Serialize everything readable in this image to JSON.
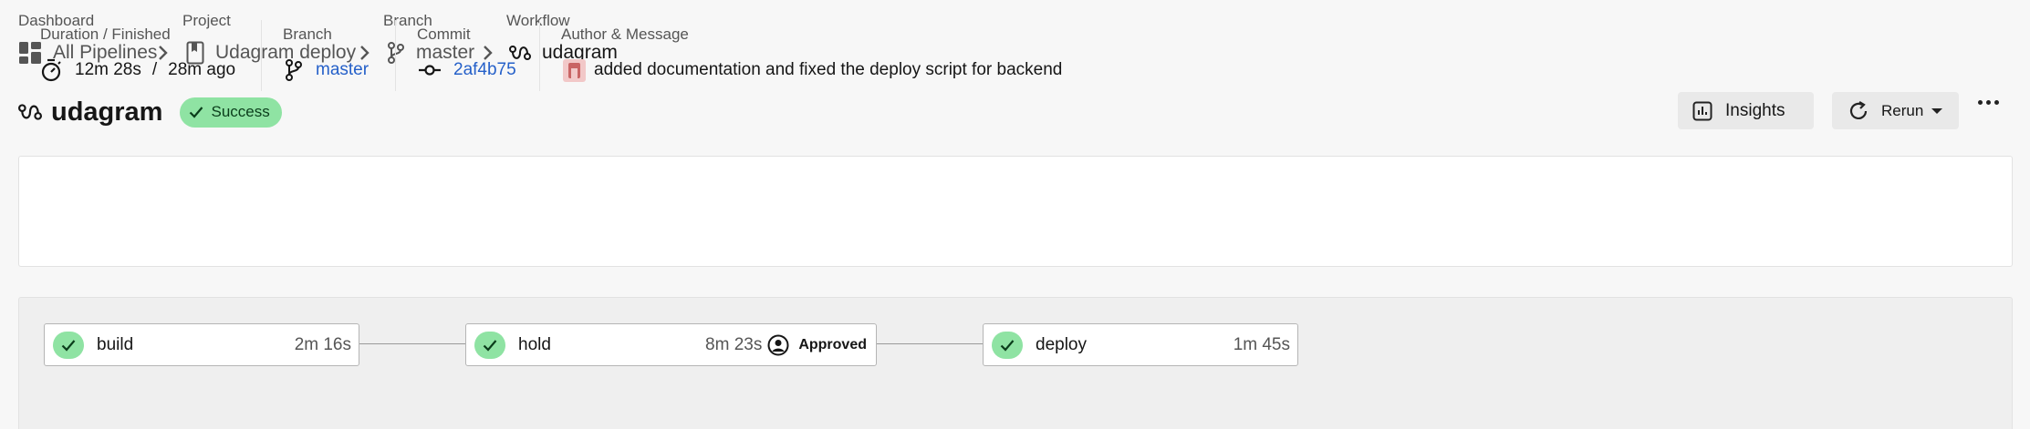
{
  "breadcrumb": {
    "dashboard": {
      "label": "Dashboard",
      "value": "All Pipelines"
    },
    "project": {
      "label": "Project",
      "value": "Udagram deploy"
    },
    "branch": {
      "label": "Branch",
      "value": "master"
    },
    "workflow": {
      "label": "Workflow",
      "value": "udagram"
    }
  },
  "header": {
    "title": "udagram",
    "status": "Success",
    "status_color": "#8fe3a3",
    "insights_label": "Insights",
    "rerun_label": "Rerun"
  },
  "summary": {
    "duration_label": "Duration / Finished",
    "duration": "12m 28s",
    "separator": "/",
    "finished": "28m ago",
    "branch_label": "Branch",
    "branch": "master",
    "commit_label": "Commit",
    "commit": "2af4b75",
    "author_label": "Author & Message",
    "message": "added documentation and fixed the deploy script for backend",
    "link_color": "#2560c9"
  },
  "jobs": [
    {
      "name": "build",
      "duration": "2m 16s"
    },
    {
      "name": "hold",
      "duration": "8m 23s",
      "approval": "Approved"
    },
    {
      "name": "deploy",
      "duration": "1m 45s"
    }
  ]
}
